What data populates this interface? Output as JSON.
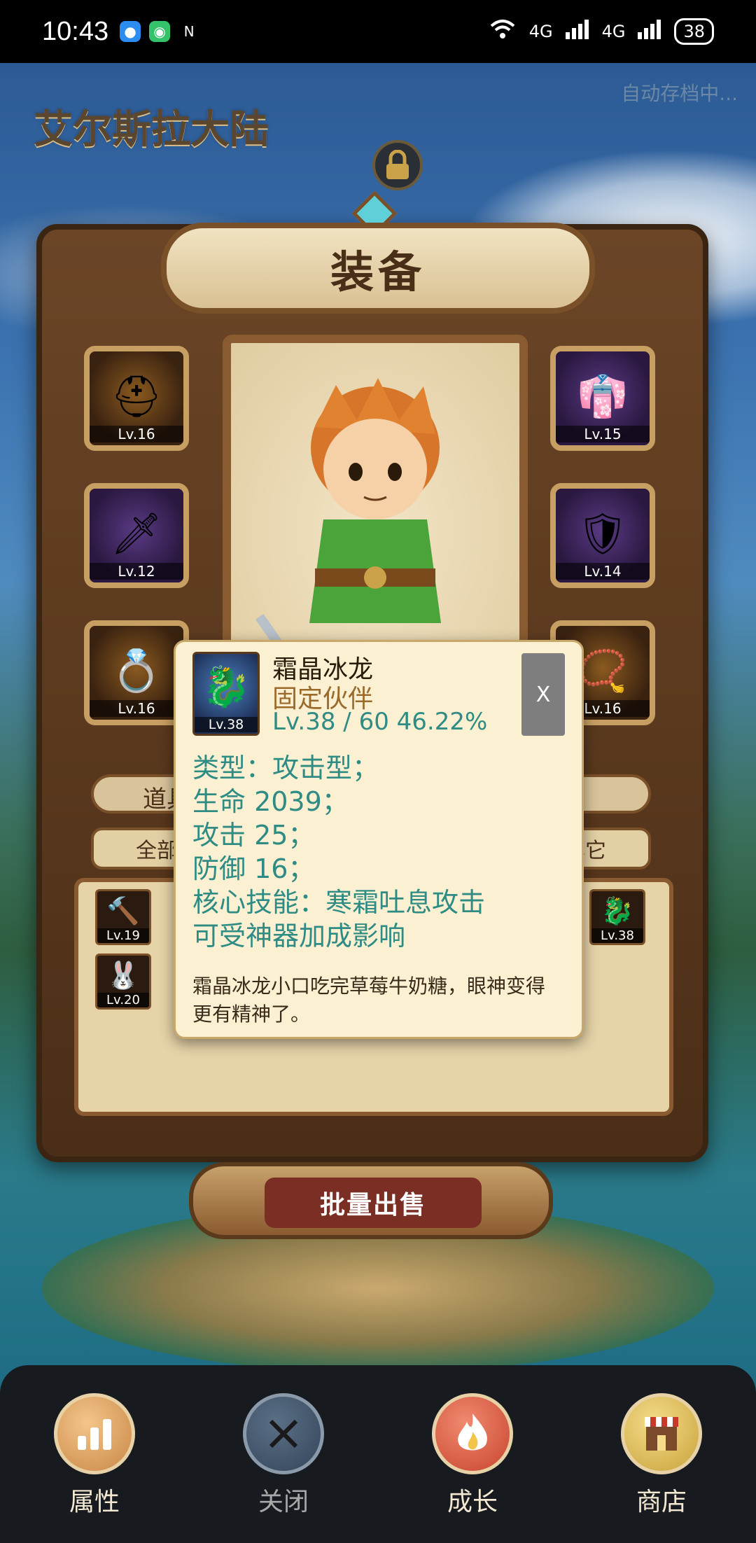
{
  "status_bar": {
    "time": "10:43",
    "network": "4G",
    "battery": "38"
  },
  "world": {
    "title": "艾尔斯拉大陆",
    "autosave": "自动存档中..."
  },
  "panel": {
    "title": "装备",
    "left_slots": [
      {
        "name": "helmet",
        "level": "Lv.16"
      },
      {
        "name": "dagger",
        "level": "Lv.12"
      },
      {
        "name": "ring",
        "level": "Lv.16"
      }
    ],
    "right_slots": [
      {
        "name": "armor",
        "level": "Lv.15"
      },
      {
        "name": "shield",
        "level": "Lv.14"
      },
      {
        "name": "amulet",
        "level": "Lv.16"
      }
    ],
    "strip_label": "道具",
    "tabs": [
      "全部",
      "",
      "",
      "其它"
    ],
    "inventory": [
      {
        "level": "Lv.19"
      },
      {
        "level": "Lv.20"
      },
      {
        "level": "Lv.38"
      }
    ],
    "sell_button": "批量出售"
  },
  "popup": {
    "name": "霜晶冰龙",
    "role": "固定伙伴",
    "icon_level": "Lv.38",
    "level_progress": "Lv.38 / 60  46.22%",
    "close": "X",
    "stats": [
      "类型：攻击型；",
      "生命 2039；",
      "攻击 25；",
      "防御 16；",
      "核心技能：寒霜吐息攻击",
      "可受神器加成影响"
    ],
    "description": "霜晶冰龙小口吃完草莓牛奶糖，眼神变得更有精神了。"
  },
  "nav": [
    {
      "label": "属性",
      "icon": "bar-chart-icon"
    },
    {
      "label": "关闭",
      "icon": "crossed-swords-icon"
    },
    {
      "label": "成长",
      "icon": "flame-icon"
    },
    {
      "label": "商店",
      "icon": "shop-icon"
    }
  ]
}
